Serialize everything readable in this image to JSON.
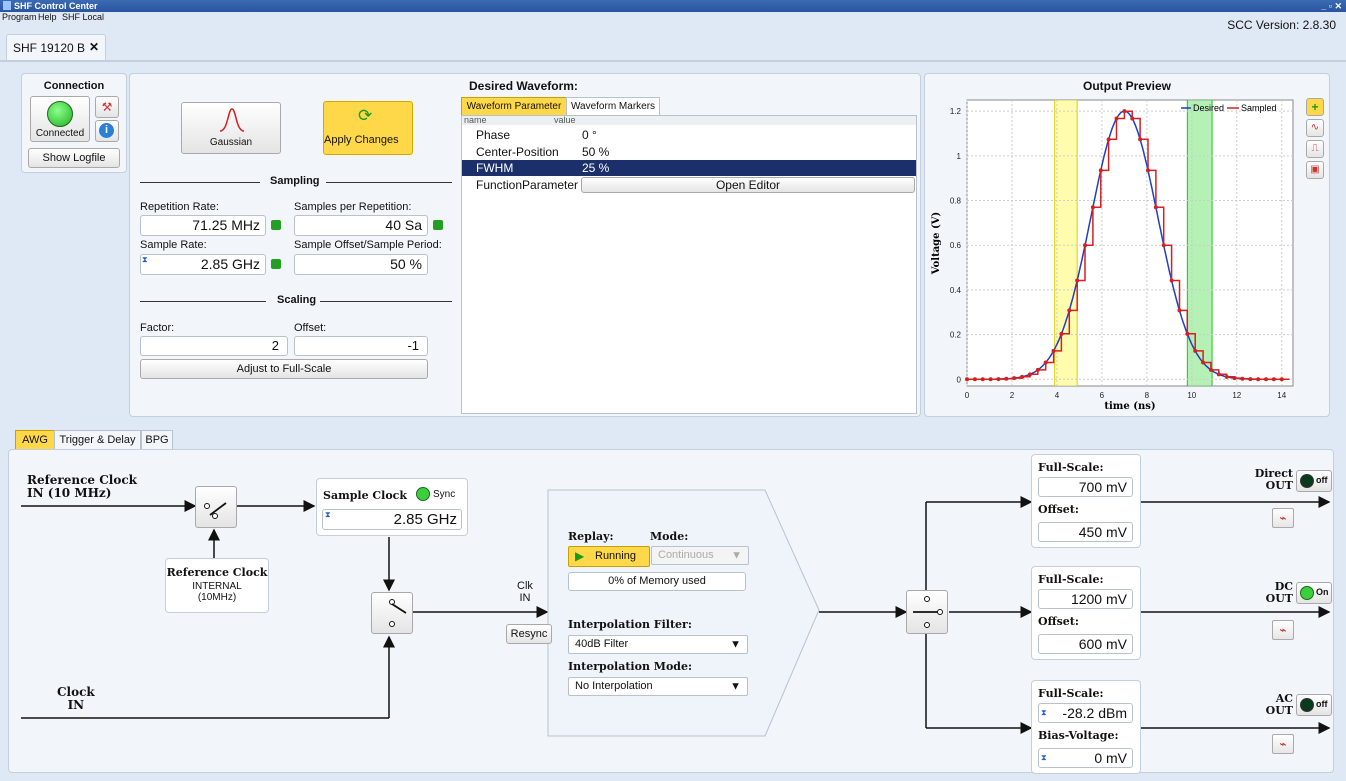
{
  "window": {
    "title": "SHF Control Center",
    "version": "SCC Version: 2.8.30"
  },
  "menu": [
    "Program",
    "Help",
    "SHF Local"
  ],
  "tab": {
    "label": "SHF 19120 B",
    "close": "✕"
  },
  "connection": {
    "title": "Connection",
    "status": "Connected",
    "logfile": "Show Logfile"
  },
  "waveform_select": {
    "name": "Gaussian",
    "apply": "Apply Changes"
  },
  "sampling": {
    "title": "Sampling",
    "rep_rate_label": "Repetition Rate:",
    "rep_rate": "71.25 MHz",
    "samples_label": "Samples per Repetition:",
    "samples": "40 Sa",
    "sample_rate_label": "Sample Rate:",
    "sample_rate": "2.85 GHz",
    "offset_label": "Sample Offset/Sample Period:",
    "offset": "50 %"
  },
  "scaling": {
    "title": "Scaling",
    "factor_label": "Factor:",
    "factor": "2",
    "offset_label": "Offset:",
    "offset": "-1",
    "adjust": "Adjust to Full-Scale"
  },
  "desired": {
    "title": "Desired Waveform:",
    "tabs": [
      "Waveform Parameter",
      "Waveform Markers"
    ],
    "col_name": "name",
    "col_value": "value",
    "rows": [
      {
        "name": "Phase",
        "value": "0 °"
      },
      {
        "name": "Center-Position",
        "value": "50 %"
      },
      {
        "name": "FWHM",
        "value": "25 %"
      }
    ],
    "fp_name": "FunctionParameter",
    "editor": "Open Editor"
  },
  "chart_data": {
    "type": "line",
    "title": "Output Preview",
    "xlabel": "time (ns)",
    "ylabel": "Voltage (V)",
    "xlim": [
      0,
      14.5
    ],
    "ylim": [
      -0.03,
      1.25
    ],
    "xticks": [
      "0",
      "2",
      "4",
      "6",
      "8",
      "10",
      "12",
      "14"
    ],
    "yticks": [
      "0",
      "0.2",
      "0.4",
      "0.6",
      "0.8",
      "1",
      "1.2"
    ],
    "legend": "top-right",
    "series": [
      {
        "name": "Desired",
        "color": "#1f3fbf",
        "kind": "gaussian",
        "center": 7.0,
        "fwhm": 3.5,
        "amplitude": 1.2
      },
      {
        "name": "Sampled",
        "color": "#d42020",
        "kind": "stepped",
        "period": 0.35,
        "center": 7.0,
        "fwhm": 3.5,
        "amplitude": 1.2
      }
    ],
    "markers": [
      {
        "x0": 3.9,
        "x1": 4.9,
        "color": "yellow"
      },
      {
        "x0": 9.8,
        "x1": 10.9,
        "color": "green"
      }
    ]
  },
  "awg_tabs": [
    "AWG",
    "Trigger & Delay",
    "BPG"
  ],
  "awg": {
    "ref_clock_in": "Reference Clock\nIN (10 MHz)",
    "ref_internal_title": "Reference Clock",
    "ref_internal_sub": "INTERNAL\n(10MHz)",
    "sample_clock_label": "Sample Clock",
    "sync": "Sync",
    "sample_clock_value": "2.85 GHz",
    "clk_in": "Clk\nIN",
    "resync": "Resync",
    "clock_in": "Clock\nIN",
    "replay_label": "Replay:",
    "mode_label": "Mode:",
    "running": "Running",
    "mode_value": "Continuous",
    "memory": "0% of Memory used",
    "interp_filter_label": "Interpolation Filter:",
    "interp_filter": "40dB Filter",
    "interp_mode_label": "Interpolation Mode:",
    "interp_mode": "No Interpolation",
    "outputs": [
      {
        "fs_label": "Full-Scale:",
        "fs": "700 mV",
        "p2_label": "Offset:",
        "p2": "450 mV",
        "out": "Direct\nOUT",
        "state": "off"
      },
      {
        "fs_label": "Full-Scale:",
        "fs": "1200 mV",
        "p2_label": "Offset:",
        "p2": "600 mV",
        "out": "DC\nOUT",
        "state": "On"
      },
      {
        "fs_label": "Full-Scale:",
        "fs": "-28.2 dBm",
        "p2_label": "Bias-Voltage:",
        "p2": "0 mV",
        "out": "AC\nOUT",
        "state": "off"
      }
    ]
  }
}
